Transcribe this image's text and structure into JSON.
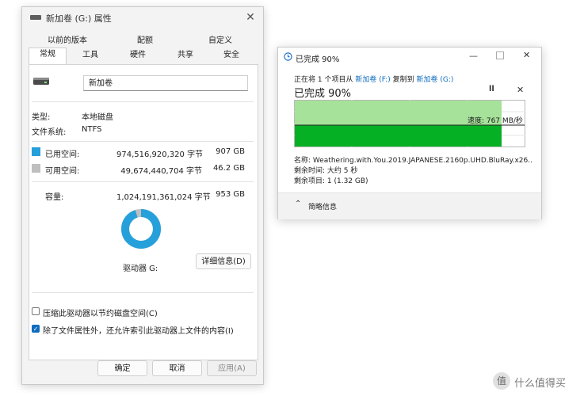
{
  "properties": {
    "title": "新加卷 (G:) 属性",
    "tabs_top": [
      "以前的版本",
      "配额",
      "自定义"
    ],
    "tabs_bottom": [
      "常规",
      "工具",
      "硬件",
      "共享",
      "安全"
    ],
    "volume_name": "新加卷",
    "type_label": "类型:",
    "type_value": "本地磁盘",
    "fs_label": "文件系统:",
    "fs_value": "NTFS",
    "used_label": "已用空间:",
    "used_bytes": "974,516,920,320 字节",
    "used_size": "907 GB",
    "free_label": "可用空间:",
    "free_bytes": "49,674,440,704 字节",
    "free_size": "46.2 GB",
    "capacity_label": "容量:",
    "capacity_bytes": "1,024,191,361,024 字节",
    "capacity_size": "953 GB",
    "used_fraction": 0.951,
    "drive_label": "驱动器 G:",
    "details_button": "详细信息(D)",
    "compress_label": "压缩此驱动器以节约磁盘空间(C)",
    "compress_checked": false,
    "index_label": "除了文件属性外，还允许索引此驱动器上文件的内容(I)",
    "index_checked": true,
    "ok_button": "确定",
    "cancel_button": "取消",
    "apply_button": "应用(A)",
    "colors": {
      "used": "#26a0da",
      "free": "#bfbfbf"
    }
  },
  "copy_dialog": {
    "title": "已完成 90%",
    "line_prefix": "正在将 1 个项目从",
    "source": "新加卷 (F:)",
    "line_mid": "复制到",
    "dest": "新加卷 (G:)",
    "heading": "已完成 90%",
    "progress": 0.9,
    "speed_label": "速度: 767 MB/秒",
    "name_line": "名称: Weathering.with.You.2019.JAPANESE.2160p.UHD.BluRay.x26...",
    "time_line": "剩余时间: 大约 5 秒",
    "items_line": "剩余项目: 1 (1.32 GB)",
    "details_toggle": "简略信息",
    "colors": {
      "bar": "#06b025",
      "history": "#a6e29a"
    }
  },
  "watermark": "什么值得买"
}
